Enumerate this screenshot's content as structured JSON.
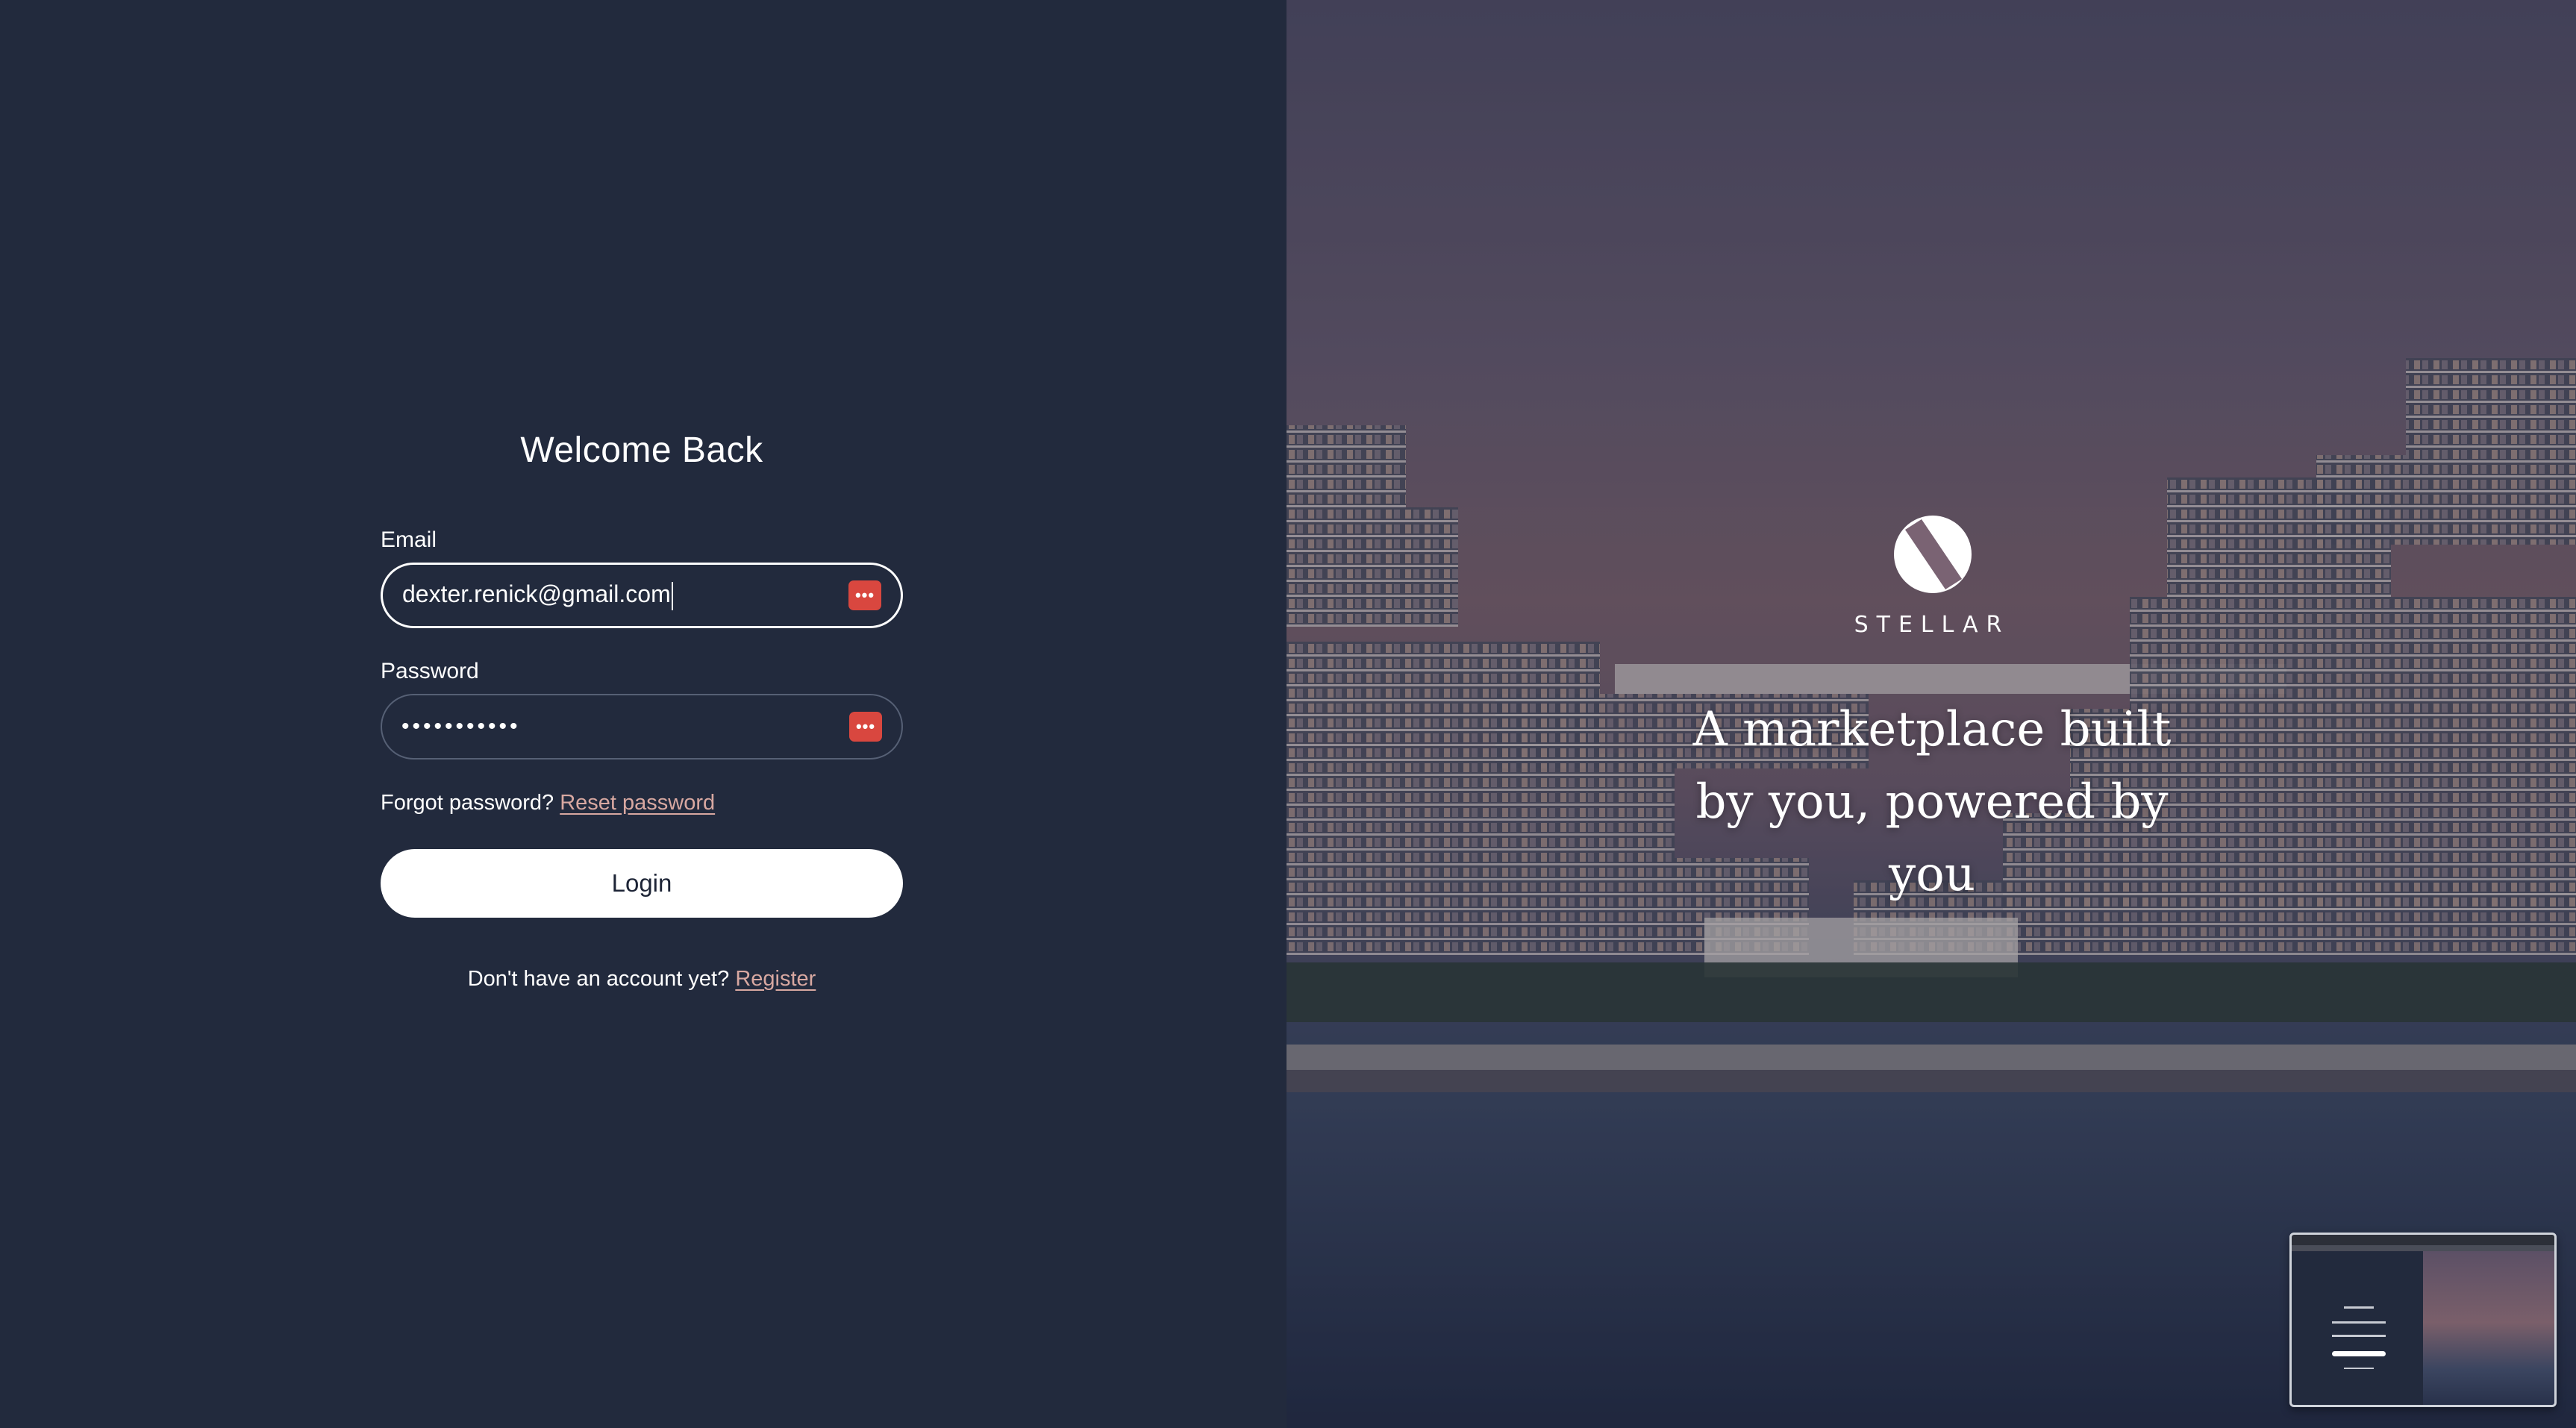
{
  "login": {
    "title": "Welcome Back",
    "email_label": "Email",
    "email_value": "dexter.renick@gmail.com",
    "password_label": "Password",
    "password_masked": "•••••••••••",
    "password_manager_icon": "key-dots-icon",
    "forgot_text": "Forgot password?",
    "reset_link": "Reset password",
    "login_button": "Login",
    "register_text": "Don't have an account yet?",
    "register_link": "Register"
  },
  "brand": {
    "name": "STELLAR",
    "tagline": "A marketplace built by you, powered by you",
    "logo_icon": "stellar-logo-icon"
  },
  "colors": {
    "background": "#222a3d",
    "accent_link": "#d8a8a1",
    "password_manager": "#d9473f",
    "button": "#ffffff"
  }
}
